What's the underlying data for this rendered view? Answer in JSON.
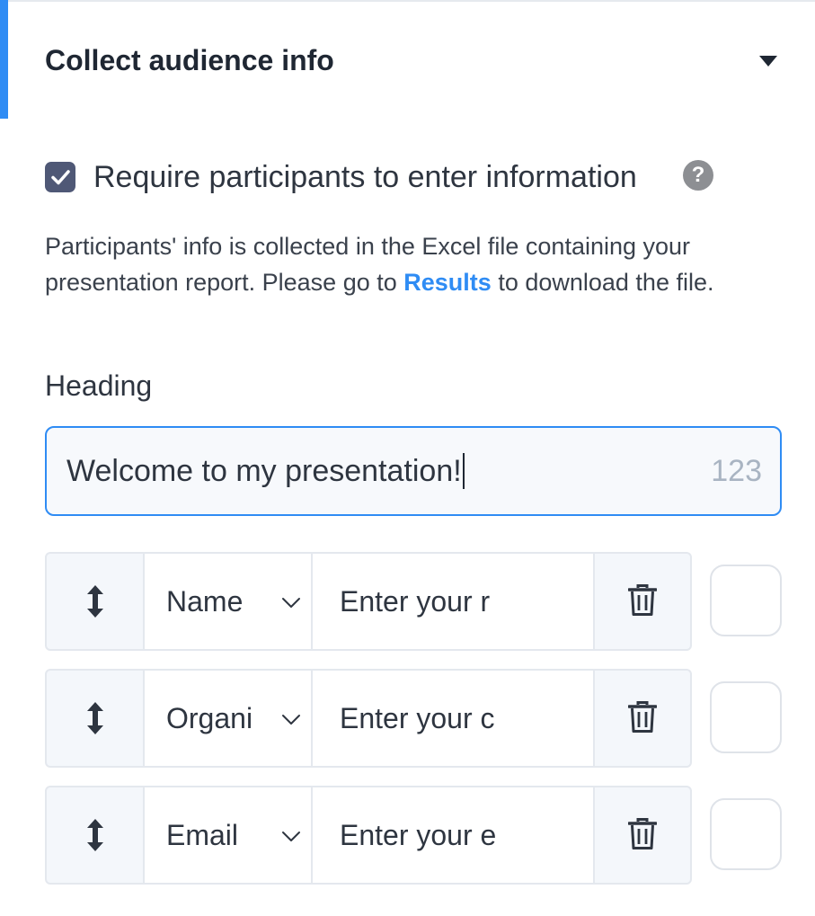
{
  "section": {
    "title": "Collect audience info",
    "accent_color": "#2f8cf4"
  },
  "require": {
    "label": "Require participants to enter information",
    "checked": true,
    "help_icon": "?"
  },
  "info": {
    "text_before": "Participants' info is collected in the Excel file containing your presentation report. Please go to ",
    "link": "Results",
    "text_after": " to download the file."
  },
  "heading": {
    "label": "Heading",
    "value": "Welcome to my presentation!",
    "char_count": "123"
  },
  "fields": [
    {
      "type": "Name",
      "placeholder": "Enter your r"
    },
    {
      "type": "Organi",
      "placeholder": "Enter your c"
    },
    {
      "type": "Email",
      "placeholder": "Enter your e"
    }
  ]
}
